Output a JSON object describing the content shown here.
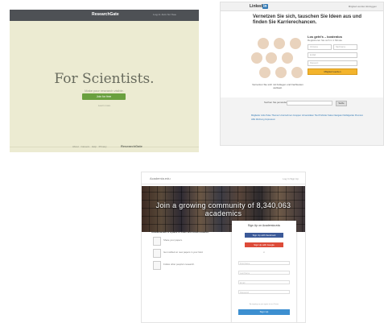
{
  "researchgate": {
    "logo": "ResearchGate",
    "toplinks": "Log in    Join for free",
    "headline": "For Scientists.",
    "subtitle": "Make your research visible.",
    "cta": "Join for free",
    "small_link": "Learn more",
    "footer": "About · Careers · Help · Privacy",
    "footer_logo": "ResearchGate"
  },
  "linkedin": {
    "logo_text": "Linked",
    "logo_in": "in",
    "toplinks": "Mitglied werden   Einloggen",
    "headline": "Vernetzen Sie sich, tauschen Sie Ideen aus und finden Sie Karrierechancen.",
    "photo_caption": "Vernetzen Sie sich mit Kollegen und Fachleuten weltweit.",
    "form": {
      "title": "Los geht's – kostenlos",
      "subtitle": "Registrieren Sie sich in 1 Minute",
      "first_name": "Vorname",
      "last_name": "Nachname",
      "email": "E-Mail",
      "password": "Passwort",
      "button": "Mitglied werden"
    },
    "search_label": "Suchen Sie jemanden",
    "search_button": "Suche",
    "directory": "Mitglieder  Jobs  Pulse  Themen  Unternehmen  Gruppen  Universitäten  Titel  Profinder  Sales Navigator  Mobilgeräte  Premium  Hilfe  Werbung  Impressum"
  },
  "academia": {
    "logo": "Academia.edu",
    "navlinks": "Log In   Sign Up",
    "join_banner": "Join a growing community of 8,340,063 academics",
    "left_title": "Academia.edu is a place to share and follow research.",
    "items": [
      "Share your papers.",
      "Get notified on new papers in your field.",
      "Follow other people's research."
    ],
    "signup": {
      "title": "Sign Up on Academia.edu",
      "facebook": "Sign Up with Facebook",
      "google": "Sign Up with Google",
      "or": "or",
      "first_name": "First Name",
      "last_name": "Last Name",
      "email": "Email",
      "password": "Password",
      "terms": "By signing up you agree to our Terms",
      "button": "Sign Up"
    }
  }
}
